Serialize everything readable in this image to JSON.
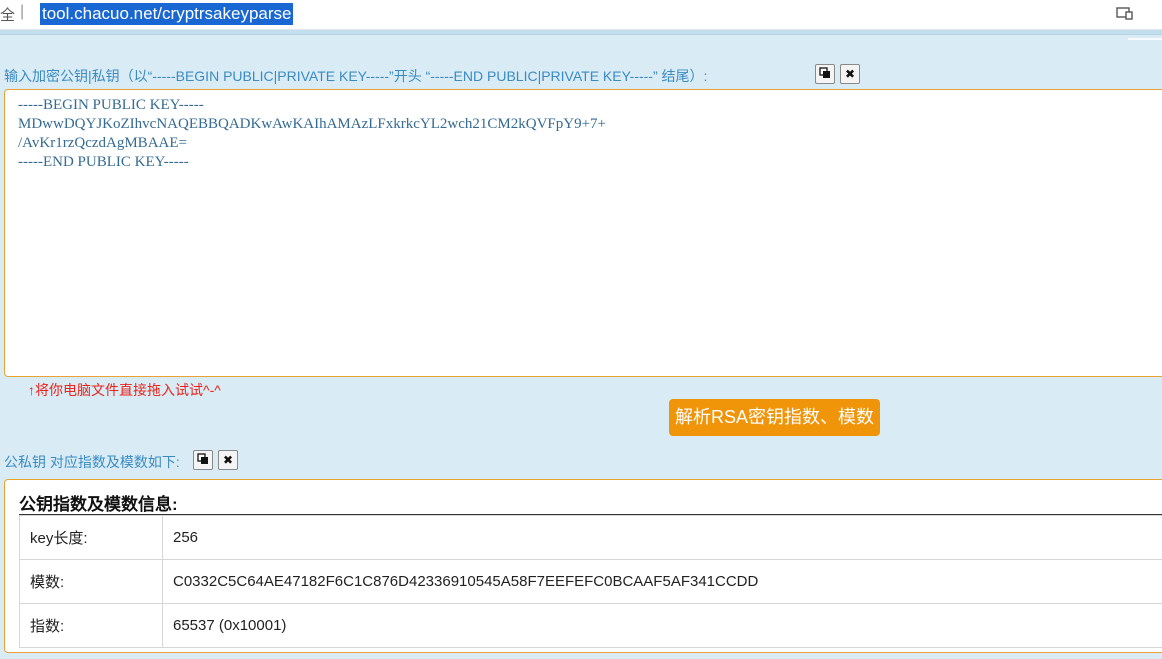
{
  "browser": {
    "secure_glyph": "全",
    "separator": "|",
    "url": "tool.chacuo.net/cryptrsakeyparse"
  },
  "input_section": {
    "label": "输入加密公钥|私钥（以“-----BEGIN PUBLIC|PRIVATE KEY-----”开头 “-----END PUBLIC|PRIVATE KEY-----” 结尾）:",
    "copy_icon": "copy-icon",
    "clear_icon": "close-icon",
    "key_text": "-----BEGIN PUBLIC KEY-----\nMDwwDQYJKoZIhvcNAQEBBQADKwAwKAIhAMAzLFxkrkcYL2wch21CM2kQVFpY9+7+\n/AvKr1rzQczdAgMBAAE=\n-----END PUBLIC KEY-----",
    "drag_hint": "↑将你电脑文件直接拖入试试^-^"
  },
  "parse_button": "解析RSA密钥指数、模数",
  "result_section": {
    "label": "公私钥 对应指数及模数如下:",
    "panel_title": "公钥指数及模数信息:",
    "rows": [
      {
        "key": "key长度:",
        "value": "256"
      },
      {
        "key": "模数:",
        "value": "C0332C5C64AE47182F6C1C876D42336910545A58F7EEFEFC0BCAAF5AF341CCDD"
      },
      {
        "key": "指数:",
        "value": "65537 (0x10001)"
      }
    ]
  }
}
